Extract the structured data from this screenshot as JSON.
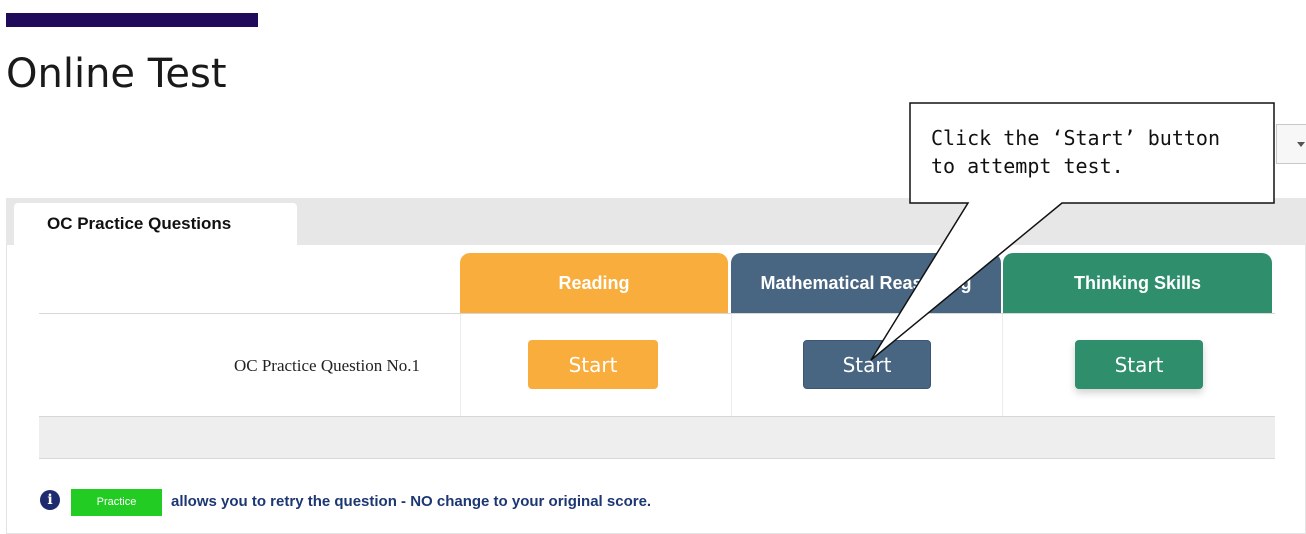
{
  "page": {
    "title": "Online Test"
  },
  "colors": {
    "brand_bar": "#200a5a",
    "reading": "#f8ad3c",
    "math": "#486582",
    "thinking": "#2f8e6b",
    "practice_badge": "#22cc22",
    "note_text": "#1d3773"
  },
  "tabs": [
    {
      "label": "OC Practice Questions",
      "active": true
    }
  ],
  "columns": [
    {
      "label": "Reading",
      "button_label": "Start"
    },
    {
      "label": "Mathematical Reasoning",
      "button_label": "Start"
    },
    {
      "label": "Thinking Skills",
      "button_label": "Start"
    }
  ],
  "rows": [
    {
      "label": "OC Practice Question No.1"
    }
  ],
  "info": {
    "icon": "info-icon",
    "icon_glyph": "i",
    "badge_label": "Practice",
    "text": "allows you to retry the question - NO change to your original score."
  },
  "callout": {
    "line1": "Click the ‘Start’ button",
    "line2": "to attempt test."
  }
}
